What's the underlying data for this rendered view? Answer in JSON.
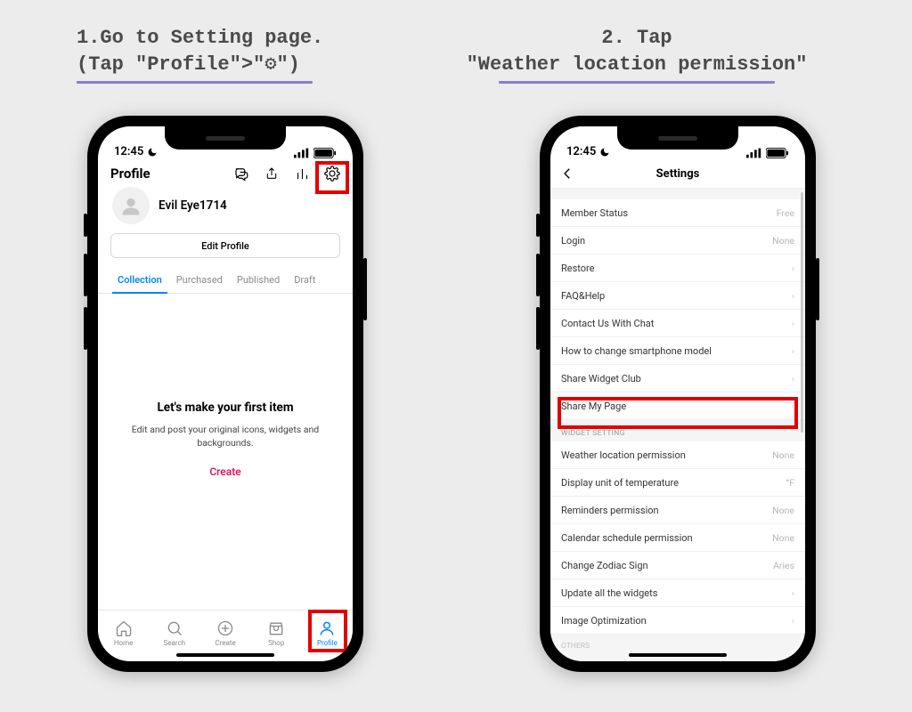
{
  "instructions": {
    "step1_line1": "1.Go to Setting page.",
    "step1_line2": "(Tap \"Profile\">\"⚙\")",
    "step2_line1": "2. Tap",
    "step2_line2": "\"Weather location permission\""
  },
  "statusbar": {
    "time": "12:45"
  },
  "profile": {
    "header_title": "Profile",
    "username": "Evil Eye1714",
    "edit_profile": "Edit Profile",
    "tabs": {
      "collection": "Collection",
      "purchased": "Purchased",
      "published": "Published",
      "draft": "Draft"
    },
    "empty_title": "Let's make your first item",
    "empty_body": "Edit and post your original icons, widgets and backgrounds.",
    "create": "Create"
  },
  "tabbar": {
    "home": "Home",
    "search": "Search",
    "create": "Create",
    "shop": "Shop",
    "profile": "Profile"
  },
  "settings": {
    "title": "Settings",
    "rows": {
      "member_status": "Member Status",
      "member_status_val": "Free",
      "login": "Login",
      "login_val": "None",
      "restore": "Restore",
      "faq": "FAQ&Help",
      "contact": "Contact Us With Chat",
      "change_model": "How to change smartphone model",
      "share_widget_club": "Share Widget Club",
      "share_my_page": "Share My Page",
      "section_widget": "WIDGET SETTING",
      "weather": "Weather location permission",
      "weather_val": "None",
      "temp_unit": "Display unit of temperature",
      "temp_unit_val": "°F",
      "reminders": "Reminders permission",
      "reminders_val": "None",
      "calendar": "Calendar schedule permission",
      "calendar_val": "None",
      "zodiac": "Change Zodiac Sign",
      "zodiac_val": "Aries",
      "update_all": "Update all the widgets",
      "image_opt": "Image Optimization",
      "others_peek": "OTHERS"
    }
  }
}
